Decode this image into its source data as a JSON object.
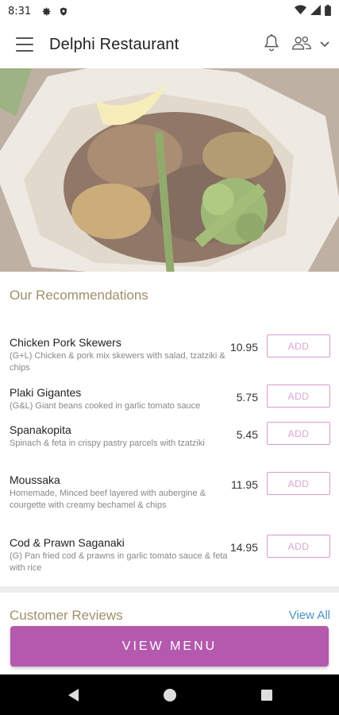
{
  "status_bar": {
    "time": "8:31"
  },
  "app_bar": {
    "title": "Delphi Restaurant"
  },
  "recommendations": {
    "title": "Our Recommendations",
    "add_label": "ADD",
    "items": [
      {
        "name": "Chicken Pork Skewers",
        "description": "(G+L) Chicken & pork mix skewers with salad, tzatziki & chips",
        "price": "10.95"
      },
      {
        "name": "Plaki Gigantes",
        "description": "(G&L) Giant beans cooked in garlic tomato sauce",
        "price": "5.75"
      },
      {
        "name": "Spanakopita",
        "description": "Spinach & feta in crispy pastry parcels with tzatziki",
        "price": "5.45"
      },
      {
        "name": "Moussaka",
        "description": "Homemade, Minced beef layered with aubergine & courgette with creamy bechamel & chips",
        "price": "11.95"
      },
      {
        "name": "Cod & Prawn Saganaki",
        "description": "(G) Pan fried cod & prawns in garlic tomato sauce & feta with rice",
        "price": "14.95"
      }
    ]
  },
  "reviews": {
    "title": "Customer Reviews",
    "view_all": "View All"
  },
  "view_menu_button": "VIEW MENU",
  "colors": {
    "accent": "#b459ad",
    "section_title": "#a08f6a",
    "link": "#4a90c4",
    "add_border": "#d99bd2"
  }
}
